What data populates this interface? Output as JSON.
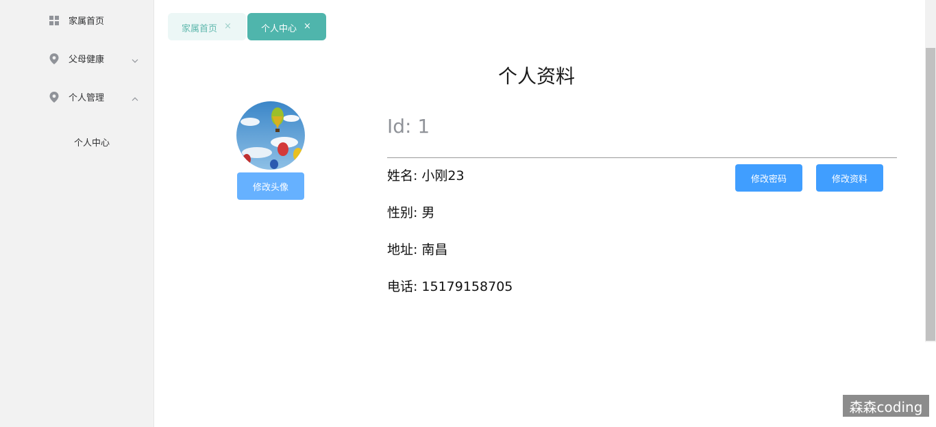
{
  "sidebar": {
    "items": [
      {
        "label": "家属首页",
        "icon": "grid-icon"
      },
      {
        "label": "父母健康",
        "icon": "location-icon",
        "arrow": "chevron-down-icon"
      },
      {
        "label": "个人管理",
        "icon": "location-icon",
        "arrow": "chevron-up-icon"
      }
    ],
    "submenu": [
      {
        "label": "个人中心"
      }
    ]
  },
  "tabs": [
    {
      "label": "家属首页",
      "close": "×"
    },
    {
      "label": "个人中心",
      "close": "×"
    }
  ],
  "page": {
    "title": "个人资料",
    "avatar_button": "修改头像",
    "id_label": "Id:",
    "id_value": "1",
    "buttons": {
      "change_password": "修改密码",
      "edit_profile": "修改资料"
    },
    "fields": [
      {
        "label": "姓名:",
        "value": "小刚23"
      },
      {
        "label": "性别:",
        "value": "男"
      },
      {
        "label": "地址:",
        "value": "南昌"
      },
      {
        "label": "电话:",
        "value": "15179158705"
      }
    ]
  },
  "watermark": "森森coding",
  "colors": {
    "sidebar_bg": "#f2f2f2",
    "tab_active": "#4fb5ac",
    "tab_inactive_bg": "#ecf7f6",
    "primary": "#409eff",
    "primary_light": "#66b1ff"
  }
}
